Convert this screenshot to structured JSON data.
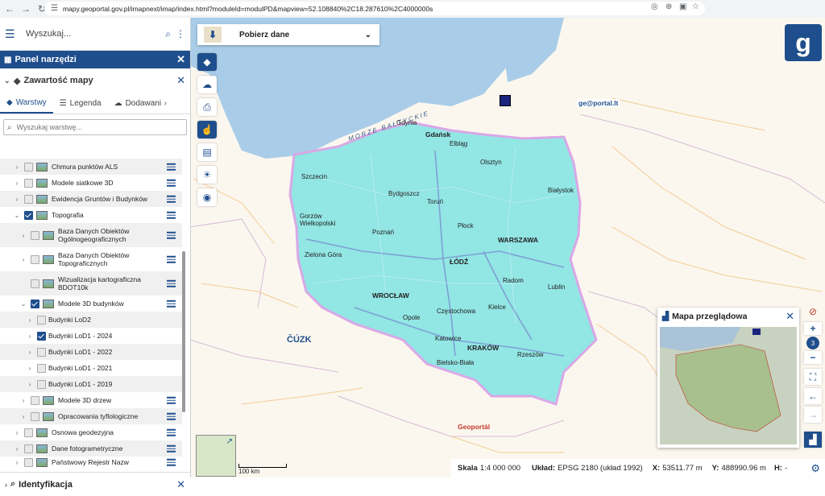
{
  "browser": {
    "url": "mapy.geoportal.gov.pl/imapnext/imap/index.html?moduleId=modulPD&mapview=52.108840%2C18.287610%2C4000000s"
  },
  "search": {
    "placeholder": "Wyszukaj..."
  },
  "panel": {
    "title": "Panel narzędzi",
    "section": "Zawartość mapy",
    "tabs": [
      "Warstwy",
      "Legenda",
      "Dodawanie"
    ],
    "layer_search_placeholder": "Wyszukaj warstwę...",
    "layers": [
      {
        "label": "Chmura punktów ALS",
        "checked": false,
        "level": 0,
        "expand": "›",
        "menu": true
      },
      {
        "label": "Modele siatkowe 3D",
        "checked": false,
        "level": 0,
        "expand": "›",
        "menu": true
      },
      {
        "label": "Ewidencja Gruntów i Budynków",
        "checked": false,
        "level": 0,
        "expand": "›",
        "menu": true
      },
      {
        "label": "Topografia",
        "checked": true,
        "level": 0,
        "expand": "⌄",
        "menu": true
      },
      {
        "label": "Baza Danych Obiektów Ogólnogeograficznych",
        "checked": false,
        "level": 1,
        "expand": "›",
        "menu": true
      },
      {
        "label": "Baza Danych Obiektów Topograficznych",
        "checked": false,
        "level": 1,
        "expand": "›",
        "menu": true
      },
      {
        "label": "Wizualizacja kartograficzna BDOT10k",
        "checked": false,
        "level": 1,
        "expand": "",
        "menu": true
      },
      {
        "label": "Modele 3D budynków",
        "checked": true,
        "level": 1,
        "expand": "⌄",
        "menu": true
      },
      {
        "label": "Budynki LoD2",
        "checked": false,
        "level": 2,
        "expand": "›",
        "menu": false
      },
      {
        "label": "Budynki LoD1 - 2024",
        "checked": true,
        "level": 2,
        "expand": "›",
        "menu": false
      },
      {
        "label": "Budynki LoD1 - 2022",
        "checked": false,
        "level": 2,
        "expand": "›",
        "menu": false
      },
      {
        "label": "Budynki LoD1 - 2021",
        "checked": false,
        "level": 2,
        "expand": "›",
        "menu": false
      },
      {
        "label": "Budynki LoD1 - 2019",
        "checked": false,
        "level": 2,
        "expand": "›",
        "menu": false
      },
      {
        "label": "Modele 3D drzew",
        "checked": false,
        "level": 1,
        "expand": "›",
        "menu": true
      },
      {
        "label": "Opracowania tyflologiczne",
        "checked": false,
        "level": 1,
        "expand": "›",
        "menu": true
      },
      {
        "label": "Osnowa geodezyjna",
        "checked": false,
        "level": 0,
        "expand": "›",
        "menu": true
      },
      {
        "label": "Dane fotogrametryczne",
        "checked": false,
        "level": 0,
        "expand": "›",
        "menu": true
      },
      {
        "label": "Państwowy Rejestr Nazw",
        "checked": false,
        "level": 0,
        "expand": "›",
        "menu": true
      }
    ],
    "identification": "Identyfikacja"
  },
  "download": {
    "label": "Pobierz dane"
  },
  "overview": {
    "title": "Mapa przeglądowa"
  },
  "zoom_level": "3",
  "map": {
    "sea_label": "MORZE BAŁTYCKIE",
    "geoportal_lt": "ge@portal.lt",
    "cuzk": "ČÚZK",
    "geoportal_sk": "Geoportál",
    "cities": [
      {
        "name": "Gdańsk",
        "bold": true
      },
      {
        "name": "Gdynia",
        "bold": false
      },
      {
        "name": "Elbląg",
        "bold": false
      },
      {
        "name": "Olsztyn",
        "bold": false
      },
      {
        "name": "Szczecin",
        "bold": false
      },
      {
        "name": "Bydgoszcz",
        "bold": false
      },
      {
        "name": "Toruń",
        "bold": false
      },
      {
        "name": "Białystok",
        "bold": false
      },
      {
        "name": "Gorzów Wielkopolski",
        "bold": false
      },
      {
        "name": "Poznań",
        "bold": false
      },
      {
        "name": "Płock",
        "bold": false
      },
      {
        "name": "WARSZAWA",
        "bold": true
      },
      {
        "name": "Zielona Góra",
        "bold": false
      },
      {
        "name": "ŁÓDŹ",
        "bold": true
      },
      {
        "name": "Radom",
        "bold": false
      },
      {
        "name": "Lublin",
        "bold": false
      },
      {
        "name": "WROCŁAW",
        "bold": true
      },
      {
        "name": "Częstochowa",
        "bold": false
      },
      {
        "name": "Kielce",
        "bold": false
      },
      {
        "name": "Opole",
        "bold": false
      },
      {
        "name": "Katowice",
        "bold": false
      },
      {
        "name": "KRAKÓW",
        "bold": true
      },
      {
        "name": "Rzeszów",
        "bold": false
      },
      {
        "name": "Bielsko-Biała",
        "bold": false
      }
    ]
  },
  "scale_bar": "100 km",
  "status": {
    "scale_label": "Skala",
    "scale_value": "1:4 000 000",
    "crs_label": "Układ:",
    "crs_value": "EPSG 2180 (układ 1992)",
    "x_label": "X:",
    "x_value": "53511.77 m",
    "y_label": "Y:",
    "y_value": "488990.96 m",
    "h_label": "H:",
    "h_value": "-"
  },
  "colors": {
    "primary": "#1f4e8c",
    "poland_fill": "#6fe0e0",
    "sea": "#a9cde8"
  }
}
